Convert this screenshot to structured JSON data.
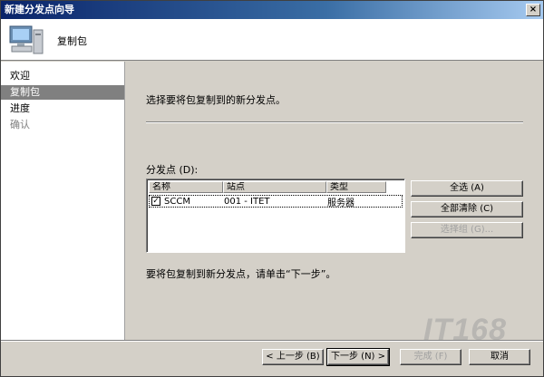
{
  "window": {
    "title": "新建分发点向导",
    "close_glyph": "×"
  },
  "header": {
    "title": "复制包",
    "icon": "computer-icon"
  },
  "steps": [
    {
      "label": "欢迎",
      "state": "normal"
    },
    {
      "label": "复制包",
      "state": "active"
    },
    {
      "label": "进度",
      "state": "normal"
    },
    {
      "label": "确认",
      "state": "disabled"
    }
  ],
  "content": {
    "intro": "选择要将包复制到的新分发点。",
    "dp_label": "分发点 (D):",
    "columns": [
      "名称",
      "站点",
      "类型"
    ],
    "rows": [
      {
        "checked": true,
        "name": "SCCM",
        "site": "001 - ITET",
        "type": "服务器"
      }
    ],
    "buttons": {
      "select_all": "全选 (A)",
      "clear_all": "全部清除 (C)",
      "select_group": "选择组 (G)..."
    },
    "hint": "要将包复制到新分发点，请单击“下一步”。"
  },
  "footer": {
    "back": "< 上一步 (B)",
    "next": "下一步 (N) >",
    "finish": "完成 (F)",
    "cancel": "取消"
  },
  "watermark": "IT168"
}
